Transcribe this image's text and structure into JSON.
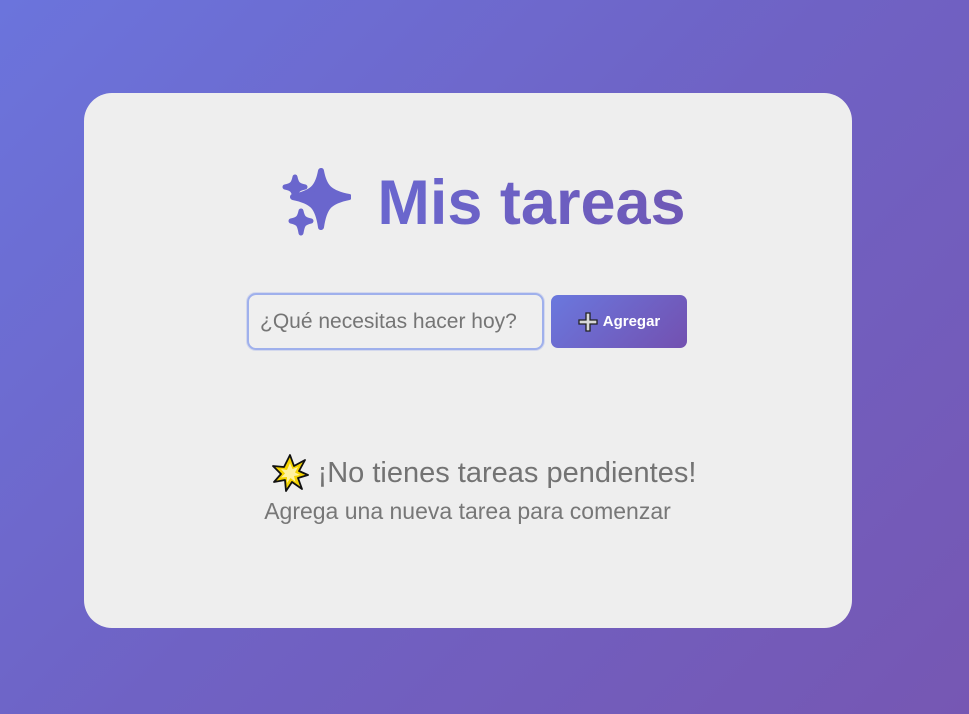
{
  "header": {
    "title": "Mis tareas",
    "icon": "sparkle-icon"
  },
  "form": {
    "input_placeholder": "¿Qué necesitas hacer hoy?",
    "input_value": "",
    "add_button_label": "Agregar",
    "add_button_icon": "plus-icon"
  },
  "empty_state": {
    "icon": "star-icon",
    "title": "¡No tienes tareas pendientes!",
    "subtitle": "Agrega una nueva tarea para comenzar"
  },
  "colors": {
    "background_start": "#6b74dc",
    "background_end": "#7657b3",
    "card": "#eeeeee",
    "title": "#6a62c8",
    "button_start": "#6a78de",
    "button_end": "#7350b0",
    "muted_text": "#737373"
  }
}
